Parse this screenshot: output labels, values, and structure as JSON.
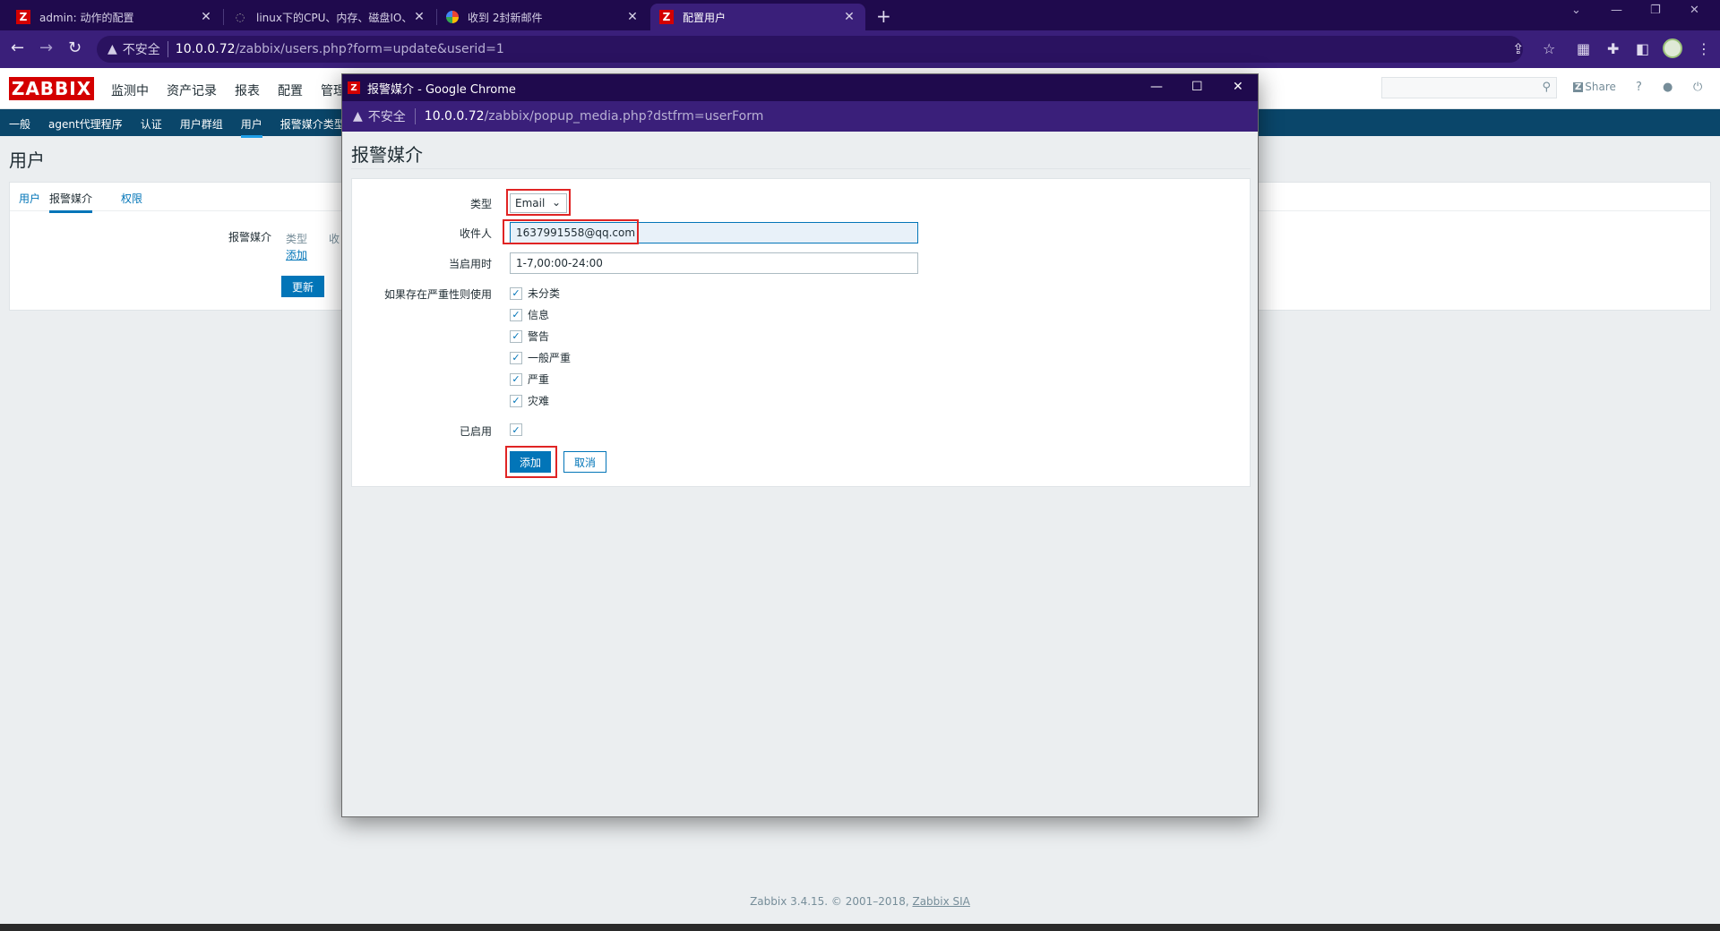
{
  "browser": {
    "tabs": [
      {
        "title": "admin: 动作的配置",
        "icon": "zabbix-favicon"
      },
      {
        "title": "linux下的CPU、内存、磁盘IO、",
        "icon": "github-favicon"
      },
      {
        "title": "收到 2封新邮件",
        "icon": "chrome-favicon"
      },
      {
        "title": "配置用户",
        "icon": "zabbix-favicon"
      }
    ],
    "address": {
      "security": "不安全",
      "host": "10.0.0.72",
      "path": "/zabbix/users.php?form=update&userid=1"
    }
  },
  "zabbix": {
    "logo": "ZABBIX",
    "menu": [
      "监测中",
      "资产记录",
      "报表",
      "配置",
      "管理"
    ],
    "share": "Share",
    "help": "?",
    "submenu": [
      "一般",
      "agent代理程序",
      "认证",
      "用户群组",
      "用户",
      "报警媒介类型"
    ],
    "page_title": "用户",
    "form_tabs": [
      "用户",
      "报警媒介",
      "权限"
    ],
    "media_label": "报警媒介",
    "media_col_type": "类型",
    "media_col_to": "收",
    "add_link": "添加",
    "update_button": "更新",
    "footer_text": "Zabbix 3.4.15. © 2001–2018, ",
    "footer_link": "Zabbix SIA"
  },
  "popup": {
    "window_title": "报警媒介 - Google Chrome",
    "address": {
      "security": "不安全",
      "host": "10.0.0.72",
      "path": "/zabbix/popup_media.php?dstfrm=userForm"
    },
    "heading": "报警媒介",
    "fields": {
      "type_label": "类型",
      "type_value": "Email",
      "sendto_label": "收件人",
      "sendto_value": "1637991558@qq.com",
      "period_label": "当启用时",
      "period_value": "1-7,00:00-24:00",
      "severity_label": "如果存在严重性则使用",
      "severities": [
        "未分类",
        "信息",
        "警告",
        "一般严重",
        "严重",
        "灾难"
      ],
      "enabled_label": "已启用"
    },
    "add_button": "添加",
    "cancel_button": "取消"
  },
  "colors": {
    "zabbix_red": "#d40000",
    "primary_blue": "#0275b8",
    "subnav_bg": "#0a466a",
    "highlight_red": "#e02424",
    "browser_dark": "#1f0a4d",
    "browser_toolbar": "#3a1f7a"
  }
}
